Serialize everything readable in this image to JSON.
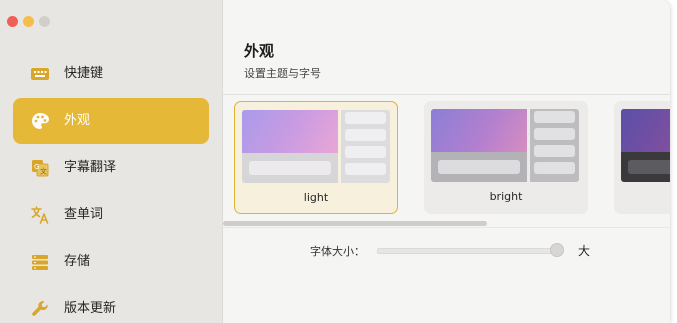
{
  "sidebar": {
    "items": [
      {
        "label": "快捷键",
        "icon": "keyboard-icon"
      },
      {
        "label": "外观",
        "icon": "palette-icon",
        "active": true
      },
      {
        "label": "字幕翻译",
        "icon": "subtitle-translate-icon"
      },
      {
        "label": "查单词",
        "icon": "translate-icon"
      },
      {
        "label": "存储",
        "icon": "storage-icon"
      },
      {
        "label": "版本更新",
        "icon": "wrench-icon"
      }
    ]
  },
  "main": {
    "title": "外观",
    "subtitle": "设置主题与字号",
    "themes": [
      {
        "label": "light",
        "selected": true
      },
      {
        "label": "bright",
        "selected": false
      },
      {
        "label": "",
        "selected": false
      }
    ],
    "font_size": {
      "label": "字体大小：",
      "max_label": "大",
      "value_fraction": 0.98
    }
  },
  "colors": {
    "accent": "#e6b837",
    "icon": "#d9a62a"
  }
}
